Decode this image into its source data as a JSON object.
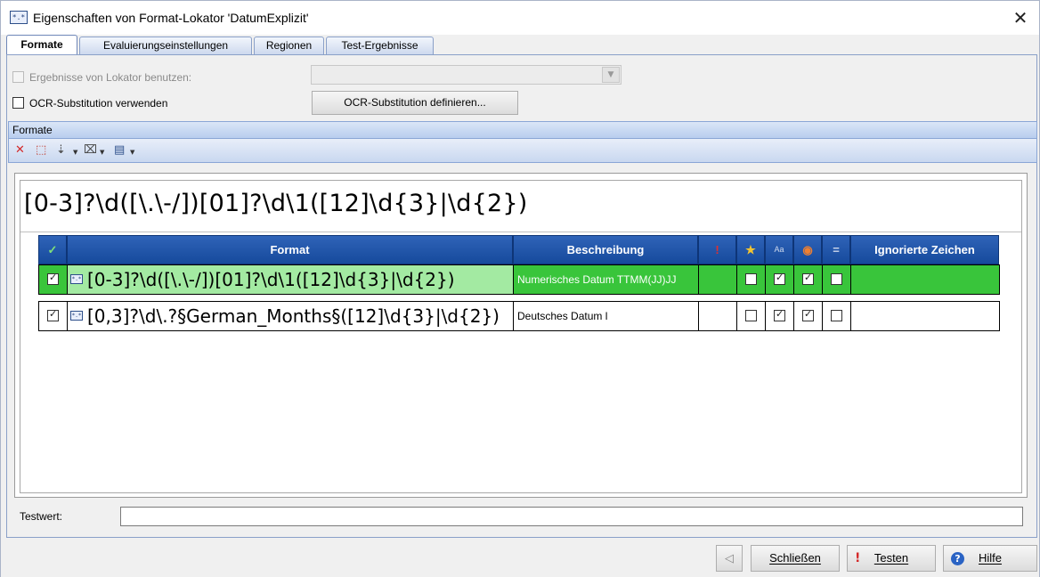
{
  "window": {
    "title": "Eigenschaften von Format-Lokator 'DatumExplizit'",
    "icon": "format-locator-icon",
    "icon_glyph": "*.*",
    "close_glyph": "✕"
  },
  "tabs": [
    {
      "label": "Formate",
      "active": true
    },
    {
      "label": "Evaluierungseinstellungen",
      "active": false
    },
    {
      "label": "Regionen",
      "active": false
    },
    {
      "label": "Test-Ergebnisse",
      "active": false
    }
  ],
  "options": {
    "use_results_label": "Ergebnisse von Lokator benutzen:",
    "use_results_checked": false,
    "use_results_enabled": false,
    "locator_value": "",
    "ocr_label": "OCR-Substitution verwenden",
    "ocr_checked": false,
    "ocr_define_button": "OCR-Substitution definieren...",
    "combo_arrow_glyph": "▼"
  },
  "formats_section": {
    "title": "Formate",
    "toolbar": [
      {
        "name": "delete-icon",
        "glyph": "✕",
        "color": "#d42a2a"
      },
      {
        "name": "new-icon",
        "glyph": "⬚"
      },
      {
        "name": "insert-icon",
        "glyph": "⇣"
      },
      {
        "name": "regex-icon",
        "glyph": "⌧"
      },
      {
        "name": "library-icon",
        "glyph": "▤"
      }
    ],
    "dropdown_glyph": "▼"
  },
  "regex_display": "[0-3]?\\d([\\.\\-/])[01]?\\d\\1([12]\\d{3}|\\d{2})",
  "grid": {
    "headers": {
      "check": "✓",
      "format": "Format",
      "description": "Beschreibung",
      "important": "!",
      "favorite": "★",
      "case": "Aa",
      "flag": "◉",
      "equal": "=",
      "ignored": "Ignorierte Zeichen"
    },
    "rows": [
      {
        "enabled": true,
        "icon_glyph": "*.*",
        "format": "[0-3]?\\d([\\.\\-/])[01]?\\d\\1([12]\\d{3}|\\d{2})",
        "description": "Numerisches Datum TTMM(JJ)JJ",
        "important": false,
        "favorite": false,
        "case": true,
        "flag": true,
        "equal": false,
        "ignored": "",
        "selected": true
      },
      {
        "enabled": true,
        "icon_glyph": "*.*",
        "format": "[0,3]?\\d\\.?§German_Months§([12]\\d{3}|\\d{2})",
        "description": "Deutsches Datum l",
        "important": false,
        "favorite": false,
        "case": true,
        "flag": true,
        "equal": false,
        "ignored": "",
        "selected": false
      }
    ]
  },
  "testwert": {
    "label": "Testwert:",
    "value": ""
  },
  "footer": {
    "back_glyph": "◁",
    "close_button": "Schließen",
    "test_button": "Testen",
    "test_icon": "!",
    "help_button": "Hilfe",
    "help_icon": "?"
  },
  "colors": {
    "selected_row": "#39c53b",
    "selected_format_cell": "#a3eaa2",
    "header_blue": "#1f55a8"
  }
}
